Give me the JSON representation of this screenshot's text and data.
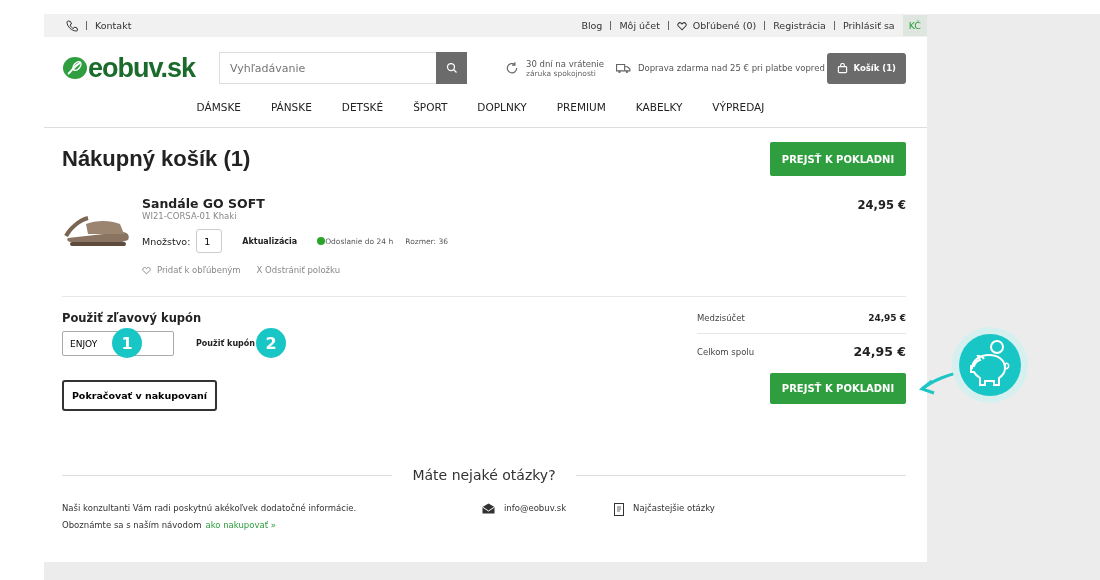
{
  "top_bar": {
    "contact": "Kontakt",
    "links": [
      "Blog",
      "Môj účet",
      "Obľúbené (0)",
      "Registrácia",
      "Prihlásiť sa"
    ],
    "currency": "KČ"
  },
  "header": {
    "logo": "eobuv.sk",
    "search": {
      "placeholder": "Vyhľadávanie"
    },
    "returns": {
      "title": "30 dní na vrátenie",
      "subtitle": "záruka spokojnosti"
    },
    "shipping": "Doprava zdarma nad 25 € pri platbe vopred",
    "cart_button": "Košík (1)"
  },
  "nav": [
    "DÁMSKE",
    "PÁNSKE",
    "DETSKÉ",
    "ŠPORT",
    "DOPLNKY",
    "PREMIUM",
    "KABELKY",
    "VÝPREDAJ"
  ],
  "cart": {
    "title": "Nákupný košík (1)",
    "checkout_button": "PREJSŤ K POKLADNI",
    "items": [
      {
        "name": "Sandále GO SOFT",
        "code": "WI21-CORSA-01 Khaki",
        "price": "24,95 €",
        "quantity_label": "Množstvo:",
        "quantity": "1",
        "update": "Aktualizácia",
        "availability": "Odoslanie do 24 h",
        "in_stock": true,
        "size": "Rozmer: 36",
        "favorite": "Pridať k obľúbeným",
        "remove": "X Odstrániť položku"
      }
    ],
    "coupon": {
      "title": "Použiť zľavový kupón",
      "value": "ENJOY",
      "apply": "Použiť kupón"
    },
    "continue_button": "Pokračovať v nakupovaní",
    "totals": [
      {
        "label": "Medzisúčet",
        "value": "24,95 €",
        "kind": "subtotal"
      },
      {
        "label": "Celkom spolu",
        "value": "24,95 €",
        "kind": "total"
      }
    ],
    "checkout_button_bottom": "PREJSŤ K POKLADNI"
  },
  "questions": {
    "title": "Máte nejaké otázky?",
    "line1": "Naši konzultanti Vám radi poskytnú akékoľvek dodatočné informácie.",
    "line2": "Oboznámte sa s naším návodom",
    "link": "ako nakupovať »",
    "email": "info@eobuv.sk",
    "faq": "Najčastejšie otázky"
  },
  "annotations": [
    "1",
    "2"
  ]
}
